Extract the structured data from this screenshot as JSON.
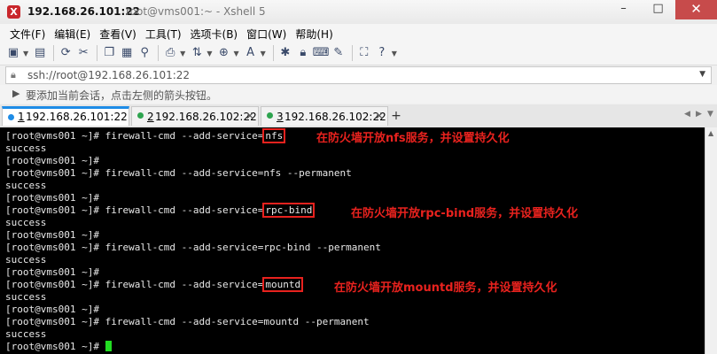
{
  "window": {
    "title": "192.168.26.101:22",
    "subtitle": "root@vms001:~ - Xshell 5",
    "app_icon_glyph": "X",
    "minimize": "–",
    "maximize": "□",
    "close": "✕"
  },
  "menu": [
    "文件(F)",
    "编辑(E)",
    "查看(V)",
    "工具(T)",
    "选项卡(B)",
    "窗口(W)",
    "帮助(H)"
  ],
  "address": {
    "value": "ssh://root@192.168.26.101:22"
  },
  "hint": {
    "text": "要添加当前会话，点击左侧的箭头按钮。"
  },
  "tabs": [
    {
      "num": "1",
      "label": " 192.168.26.101:22",
      "close": "✕",
      "active": true
    },
    {
      "num": "2",
      "label": " 192.168.26.102:22",
      "close": "✕",
      "active": false
    },
    {
      "num": "3",
      "label": " 192.168.26.102:22",
      "close": "✕",
      "active": false
    }
  ],
  "tab_add": "+",
  "terminal": {
    "lines": [
      {
        "prefix": "[root@vms001 ~]# firewall-cmd --add-service=",
        "hl": "nfs",
        "rest": ""
      },
      {
        "prefix": "success",
        "hl": "",
        "rest": ""
      },
      {
        "prefix": "[root@vms001 ~]#",
        "hl": "",
        "rest": ""
      },
      {
        "prefix": "[root@vms001 ~]# firewall-cmd --add-service=nfs --permanent",
        "hl": "",
        "rest": ""
      },
      {
        "prefix": "success",
        "hl": "",
        "rest": ""
      },
      {
        "prefix": "[root@vms001 ~]#",
        "hl": "",
        "rest": ""
      },
      {
        "prefix": "[root@vms001 ~]# firewall-cmd --add-service=",
        "hl": "rpc-bind",
        "rest": ""
      },
      {
        "prefix": "success",
        "hl": "",
        "rest": ""
      },
      {
        "prefix": "[root@vms001 ~]#",
        "hl": "",
        "rest": ""
      },
      {
        "prefix": "[root@vms001 ~]# firewall-cmd --add-service=rpc-bind --permanent",
        "hl": "",
        "rest": ""
      },
      {
        "prefix": "success",
        "hl": "",
        "rest": ""
      },
      {
        "prefix": "[root@vms001 ~]#",
        "hl": "",
        "rest": ""
      },
      {
        "prefix": "[root@vms001 ~]# firewall-cmd --add-service=",
        "hl": "mountd",
        "rest": ""
      },
      {
        "prefix": "success",
        "hl": "",
        "rest": ""
      },
      {
        "prefix": "[root@vms001 ~]#",
        "hl": "",
        "rest": ""
      },
      {
        "prefix": "[root@vms001 ~]# firewall-cmd --add-service=mountd --permanent",
        "hl": "",
        "rest": ""
      },
      {
        "prefix": "success",
        "hl": "",
        "rest": ""
      },
      {
        "prefix": "[root@vms001 ~]# ",
        "hl": "",
        "rest": "",
        "cursor": true
      }
    ],
    "annotations": [
      "在防火墙开放nfs服务，并设置持久化",
      "在防火墙开放rpc-bind服务，并设置持久化",
      "在防火墙开放mountd服务，并设置持久化"
    ]
  },
  "colors": {
    "annotation": "#e8221e",
    "cursor": "#22dd22",
    "terminal_bg": "#000000",
    "tab_accent": "#1e8ce6"
  }
}
